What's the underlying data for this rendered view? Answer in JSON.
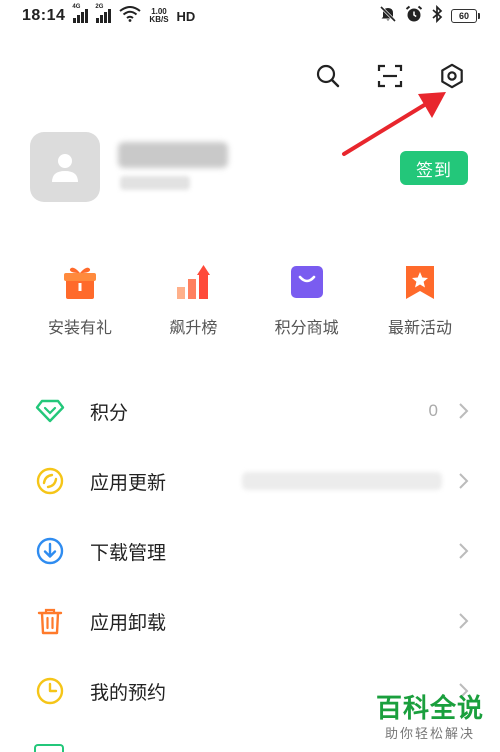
{
  "status_bar": {
    "time": "18:14",
    "network_1": "4G",
    "network_2": "2G",
    "speed_value": "1.00",
    "speed_unit": "KB/S",
    "hd": "HD",
    "battery": "60"
  },
  "top_actions": {
    "search_icon": "search-icon",
    "scan_icon": "scan-icon",
    "settings_icon": "settings-icon"
  },
  "profile": {
    "sign_in_label": "签到"
  },
  "quick_entries": [
    {
      "label": "安装有礼",
      "icon": "gift-icon",
      "color": "#ff6a2b"
    },
    {
      "label": "飙升榜",
      "icon": "rising-chart-icon",
      "color": "#ff5a3a"
    },
    {
      "label": "积分商城",
      "icon": "shopping-bag-icon",
      "color": "#7a5cf0"
    },
    {
      "label": "最新活动",
      "icon": "star-ribbon-icon",
      "color": "#ff6a2b"
    }
  ],
  "menu": [
    {
      "label": "积分",
      "value": "0",
      "icon": "diamond-icon",
      "color": "#23c77a"
    },
    {
      "label": "应用更新",
      "icon": "refresh-icon",
      "color": "#f5c518"
    },
    {
      "label": "下载管理",
      "icon": "download-icon",
      "color": "#2f8cf0"
    },
    {
      "label": "应用卸载",
      "icon": "trash-icon",
      "color": "#ff7a2b"
    },
    {
      "label": "我的预约",
      "icon": "clock-icon",
      "color": "#f5c518"
    }
  ],
  "watermark": {
    "main": "百科全说",
    "sub": "助你轻松解决"
  },
  "colors": {
    "accent_green": "#23c77a",
    "arrow_red": "#e8262d"
  }
}
